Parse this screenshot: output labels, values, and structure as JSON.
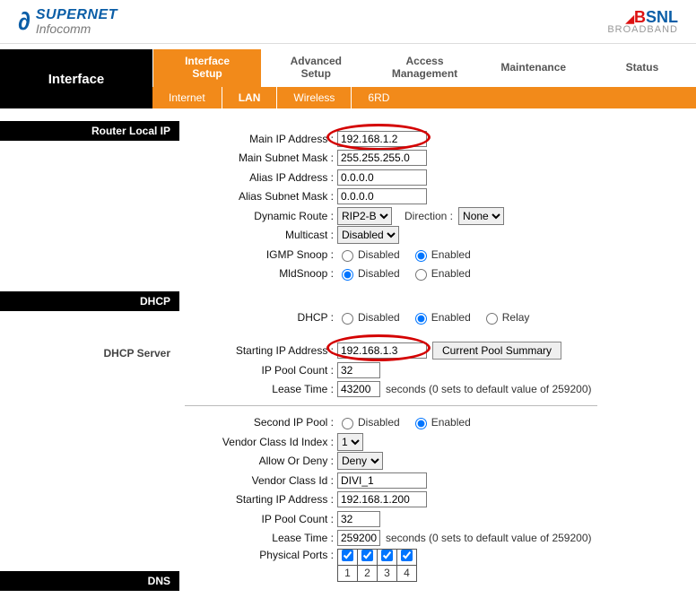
{
  "brand": {
    "left_line1": "SUPERNET",
    "left_line2": "Infocomm",
    "right_name": "BSNL",
    "right_sub": "BROADBAND"
  },
  "nav": {
    "page_title": "Interface",
    "tabs": {
      "interface_setup": "Interface\nSetup",
      "advanced_setup": "Advanced\nSetup",
      "access_management": "Access\nManagement",
      "maintenance": "Maintenance",
      "status": "Status"
    },
    "subtabs": {
      "internet": "Internet",
      "lan": "LAN",
      "wireless": "Wireless",
      "sixrd": "6RD"
    }
  },
  "sections": {
    "router_local_ip": "Router Local IP",
    "dhcp": "DHCP",
    "dhcp_server": "DHCP Server",
    "dns": "DNS"
  },
  "labels": {
    "main_ip": "Main IP Address :",
    "main_mask": "Main Subnet Mask :",
    "alias_ip": "Alias IP Address :",
    "alias_mask": "Alias Subnet Mask :",
    "dynamic_route": "Dynamic Route :",
    "direction": "Direction :",
    "multicast": "Multicast :",
    "igmp": "IGMP Snoop :",
    "mld": "MldSnoop :",
    "dhcp": "DHCP :",
    "start_ip": "Starting IP Address :",
    "pool_count": "IP Pool Count :",
    "lease": "Lease Time :",
    "seconds_note": "seconds   (0 sets to default value of 259200)",
    "second_pool": "Second IP Pool :",
    "vci_index": "Vendor Class Id Index :",
    "allow_deny": "Allow Or Deny :",
    "vci": "Vendor Class Id :",
    "phys_ports": "Physical Ports :",
    "pool_summary_btn": "Current Pool Summary"
  },
  "options": {
    "disabled": "Disabled",
    "enabled": "Enabled",
    "relay": "Relay",
    "none": "None",
    "rip2b": "RIP2-B",
    "deny": "Deny",
    "one": "1"
  },
  "values": {
    "main_ip": "192.168.1.2",
    "main_mask": "255.255.255.0",
    "alias_ip": "0.0.0.0",
    "alias_mask": "0.0.0.0",
    "dhcp_start_ip": "192.168.1.3",
    "dhcp_pool_count": "32",
    "dhcp_lease": "43200",
    "vci": "DIVI_1",
    "second_start_ip": "192.168.1.200",
    "second_pool_count": "32",
    "second_lease": "259200"
  },
  "ports": [
    "1",
    "2",
    "3",
    "4"
  ]
}
